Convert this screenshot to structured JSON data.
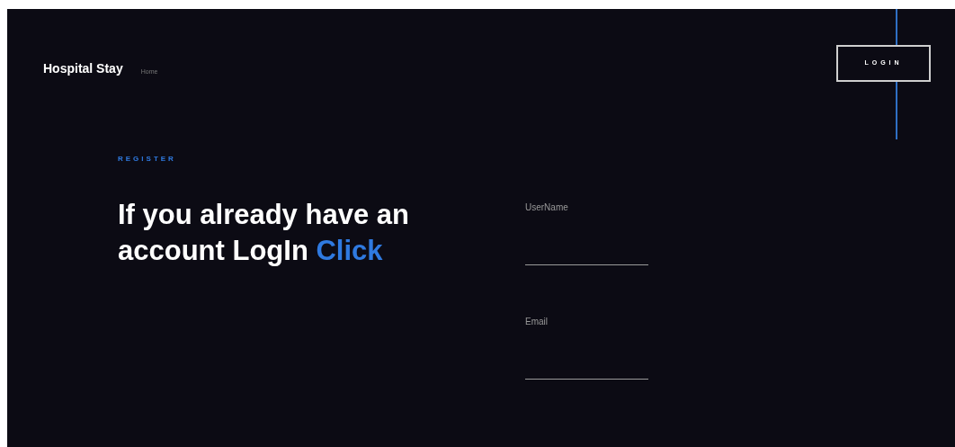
{
  "navbar": {
    "brand": "Hospital Stay",
    "links": [
      {
        "label": "Home",
        "selected": false
      }
    ],
    "login_button": "LOGIN"
  },
  "hero": {
    "eyebrow": "REGISTER",
    "heading": "If you already have an account LogIn",
    "link": "Click"
  },
  "form": {
    "fields": [
      {
        "label": "UserName"
      },
      {
        "label": "Email"
      }
    ]
  }
}
